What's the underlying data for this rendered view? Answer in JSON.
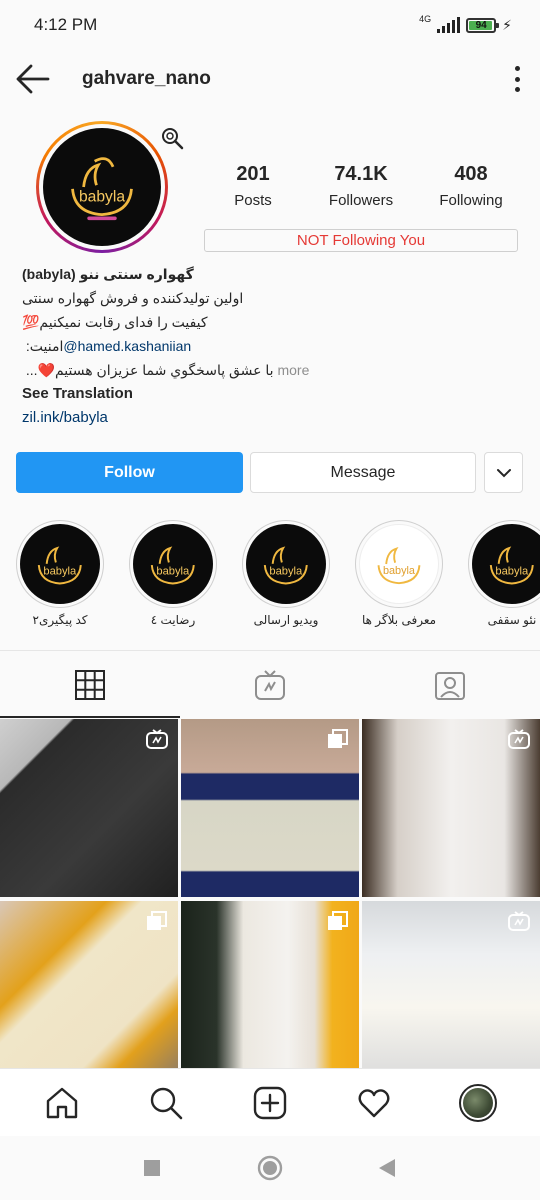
{
  "status": {
    "time": "4:12 PM",
    "network": "4G",
    "battery": "94",
    "battery_level": 0.94
  },
  "header": {
    "username": "gahvare_nano"
  },
  "profile": {
    "logo_text": "babyla",
    "stats": [
      {
        "value": "201",
        "label": "Posts"
      },
      {
        "value": "74.1K",
        "label": "Followers"
      },
      {
        "value": "408",
        "label": "Following"
      }
    ],
    "follow_status": "NOT Following You"
  },
  "bio": {
    "name_line_part1": "(babyla)",
    "name_line_part2": "گهواره سنتی ننو",
    "line2": "اولین تولیدکننده و فروش گهواره سنتی",
    "line3": "کیفیت را فدای رقابت نمیکنیم💯",
    "line4_prefix": "امنیت:",
    "mention": "@hamed.kashaniian",
    "line5": "با عشق پاسخگوي شما عزيزان هستيم❤️...",
    "more": "more",
    "see_translation": "See Translation",
    "link": "zil.ink/babyla"
  },
  "actions": {
    "follow": "Follow",
    "message": "Message"
  },
  "highlights": [
    {
      "label": "کد پیگیری۲"
    },
    {
      "label": "رضایت ٤"
    },
    {
      "label": "ویدیو ارسالی"
    },
    {
      "label": "معرفی بلاگر ها"
    },
    {
      "label": "نئو سقفی"
    }
  ],
  "colors": {
    "accent": "#2196f3",
    "alert": "#e53935",
    "link": "#00376b"
  },
  "icons": {
    "back": "back-arrow-icon",
    "more": "more-vertical-icon",
    "dropdown": "chevron-down-icon",
    "tab_grid": "grid-icon",
    "tab_igtv": "igtv-icon",
    "tab_tagged": "tagged-icon",
    "home": "home-icon",
    "search": "search-icon",
    "add": "add-post-icon",
    "activity": "heart-icon"
  }
}
